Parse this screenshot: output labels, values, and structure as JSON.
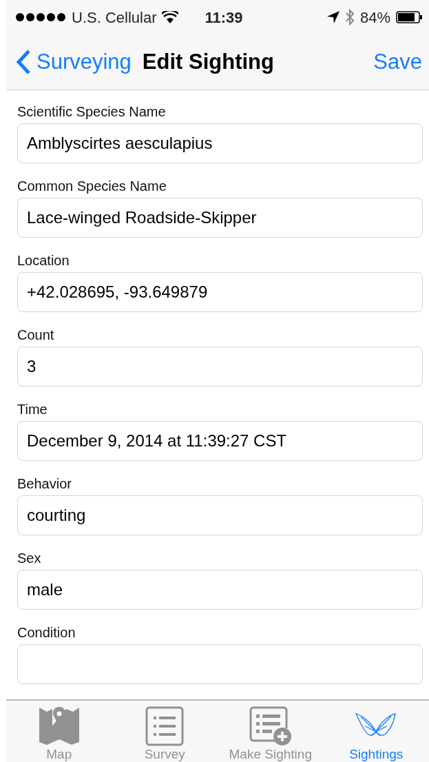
{
  "status_bar": {
    "carrier": "U.S. Cellular",
    "time": "11:39",
    "battery": "84%"
  },
  "nav": {
    "back": "Surveying",
    "title": "Edit Sighting",
    "action": "Save"
  },
  "fields": [
    {
      "label": "Scientific Species Name",
      "value": "Amblyscirtes aesculapius"
    },
    {
      "label": "Common Species Name",
      "value": "Lace-winged Roadside-Skipper"
    },
    {
      "label": "Location",
      "value": "+42.028695, -93.649879"
    },
    {
      "label": "Count",
      "value": "3"
    },
    {
      "label": "Time",
      "value": "December 9, 2014 at 11:39:27 CST"
    },
    {
      "label": "Behavior",
      "value": "courting"
    },
    {
      "label": "Sex",
      "value": "male"
    },
    {
      "label": "Condition"
    }
  ],
  "tabs": [
    {
      "label": "Map",
      "kind": "map",
      "selected": false
    },
    {
      "label": "Survey",
      "kind": "list",
      "selected": false
    },
    {
      "label": "Make Sighting",
      "kind": "add-list",
      "selected": false
    },
    {
      "label": "Sightings",
      "kind": "butterfly",
      "selected": true
    }
  ]
}
